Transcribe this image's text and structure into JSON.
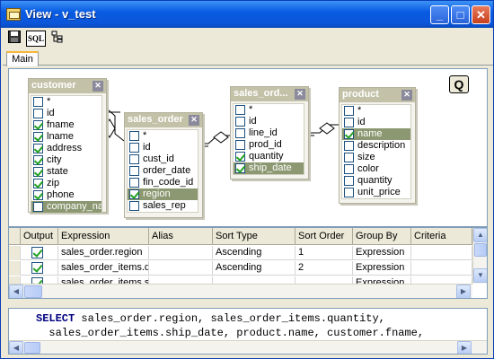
{
  "window": {
    "title": "View - v_test",
    "minimize": "_",
    "maximize": "□",
    "close": "✕"
  },
  "toolbar": {
    "save_icon": "save-icon",
    "sql_label": "SQL",
    "tree_icon": "tree-icon"
  },
  "tabs": [
    {
      "label": "Main"
    }
  ],
  "designer": {
    "q_label": "Q"
  },
  "tables": [
    {
      "title": "customer",
      "close": "✕",
      "fields": [
        {
          "name": "*",
          "checked": false,
          "selected": false
        },
        {
          "name": "id",
          "checked": false,
          "selected": false
        },
        {
          "name": "fname",
          "checked": true,
          "selected": false
        },
        {
          "name": "lname",
          "checked": true,
          "selected": false
        },
        {
          "name": "address",
          "checked": true,
          "selected": false
        },
        {
          "name": "city",
          "checked": true,
          "selected": false
        },
        {
          "name": "state",
          "checked": true,
          "selected": false
        },
        {
          "name": "zip",
          "checked": true,
          "selected": false
        },
        {
          "name": "phone",
          "checked": true,
          "selected": false
        },
        {
          "name": "company_name",
          "checked": false,
          "selected": true
        }
      ]
    },
    {
      "title": "sales_order",
      "close": "✕",
      "fields": [
        {
          "name": "*",
          "checked": false,
          "selected": false
        },
        {
          "name": "id",
          "checked": false,
          "selected": false
        },
        {
          "name": "cust_id",
          "checked": false,
          "selected": false
        },
        {
          "name": "order_date",
          "checked": false,
          "selected": false
        },
        {
          "name": "fin_code_id",
          "checked": false,
          "selected": false
        },
        {
          "name": "region",
          "checked": true,
          "selected": true
        },
        {
          "name": "sales_rep",
          "checked": false,
          "selected": false
        }
      ]
    },
    {
      "title": "sales_ord...",
      "close": "✕",
      "fields": [
        {
          "name": "*",
          "checked": false,
          "selected": false
        },
        {
          "name": "id",
          "checked": false,
          "selected": false
        },
        {
          "name": "line_id",
          "checked": false,
          "selected": false
        },
        {
          "name": "prod_id",
          "checked": false,
          "selected": false
        },
        {
          "name": "quantity",
          "checked": true,
          "selected": false
        },
        {
          "name": "ship_date",
          "checked": true,
          "selected": true
        }
      ]
    },
    {
      "title": "product",
      "close": "✕",
      "fields": [
        {
          "name": "*",
          "checked": false,
          "selected": false
        },
        {
          "name": "id",
          "checked": false,
          "selected": false
        },
        {
          "name": "name",
          "checked": true,
          "selected": true
        },
        {
          "name": "description",
          "checked": false,
          "selected": false
        },
        {
          "name": "size",
          "checked": false,
          "selected": false
        },
        {
          "name": "color",
          "checked": false,
          "selected": false
        },
        {
          "name": "quantity",
          "checked": false,
          "selected": false
        },
        {
          "name": "unit_price",
          "checked": false,
          "selected": false
        }
      ]
    }
  ],
  "grid": {
    "columns": [
      "Output",
      "Expression",
      "Alias",
      "Sort Type",
      "Sort Order",
      "Group By",
      "Criteria"
    ],
    "rows": [
      {
        "output": true,
        "expression": "sales_order.region",
        "alias": "",
        "sort_type": "Ascending",
        "sort_order": "1",
        "group_by": "Expression",
        "criteria": ""
      },
      {
        "output": true,
        "expression": "sales_order_items.quantity",
        "alias": "",
        "sort_type": "Ascending",
        "sort_order": "2",
        "group_by": "Expression",
        "criteria": ""
      },
      {
        "output": true,
        "expression": "sales_order_items.ship_date",
        "alias": "",
        "sort_type": "",
        "sort_order": "",
        "group_by": "Expression",
        "criteria": ""
      }
    ]
  },
  "sql": {
    "keyword": "SELECT",
    "line1_rest": " sales_order.region, sales_order_items.quantity,",
    "line2": "  sales_order_items.ship_date, product.name, customer.fname,"
  },
  "colors": {
    "title_bar": "#0a5ce3",
    "table_header": "#c3c1a7",
    "selected_field": "#8c9871",
    "check": "#21a121"
  }
}
